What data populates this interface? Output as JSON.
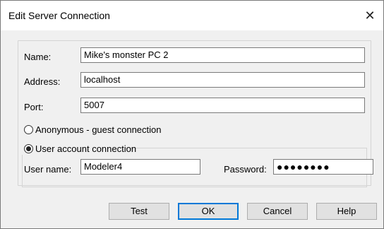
{
  "window": {
    "title": "Edit Server Connection",
    "close_icon": "close-icon"
  },
  "form": {
    "name_label": "Name:",
    "name_value": "Mike's monster PC 2",
    "address_label": "Address:",
    "address_value": "localhost",
    "port_label": "Port:",
    "port_value": "5007",
    "anonymous_label": "Anonymous - guest connection",
    "anonymous_selected": false,
    "user_account_label": "User account connection",
    "user_account_selected": true,
    "username_label": "User name:",
    "username_value": "Modeler4",
    "password_label": "Password:",
    "password_value": "●●●●●●●●"
  },
  "buttons": {
    "test": "Test",
    "ok": "OK",
    "cancel": "Cancel",
    "help": "Help"
  }
}
